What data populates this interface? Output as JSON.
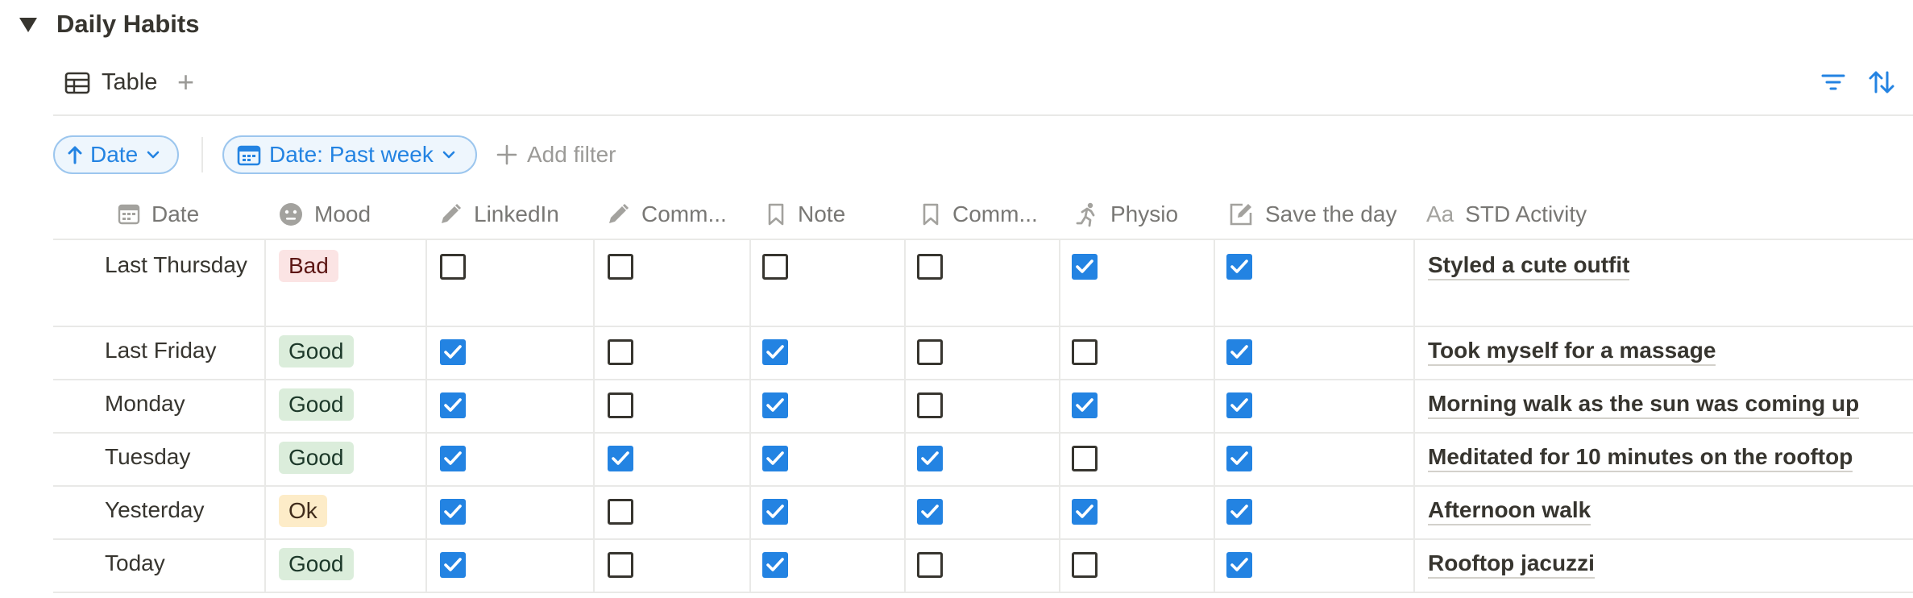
{
  "section": {
    "title": "Daily Habits"
  },
  "views": {
    "active_tab": "Table",
    "add_view_glyph": "+"
  },
  "toolbar": {
    "filter_icon": "filter-icon",
    "sort_icon": "sort-icon"
  },
  "filters": {
    "sort_pill": "Date",
    "date_filter_pill": "Date: Past week",
    "add_filter": "Add filter"
  },
  "columns": [
    {
      "label": "Date",
      "icon": "calendar-icon"
    },
    {
      "label": "Mood",
      "icon": "face-icon"
    },
    {
      "label": "LinkedIn",
      "icon": "pencil-icon"
    },
    {
      "label": "Comm...",
      "icon": "pencil-icon"
    },
    {
      "label": "Note",
      "icon": "bookmark-icon"
    },
    {
      "label": "Comm...",
      "icon": "bookmark-icon"
    },
    {
      "label": "Physio",
      "icon": "runner-icon"
    },
    {
      "label": "Save the day",
      "icon": "edit-square-icon"
    },
    {
      "label": "STD Activity",
      "icon": "text-aa-icon"
    }
  ],
  "mood_colors": {
    "Bad": {
      "bg": "#fbe4e4",
      "fg": "#5d1715"
    },
    "Good": {
      "bg": "#dbeddb",
      "fg": "#1c3829"
    },
    "Ok": {
      "bg": "#fdecc8",
      "fg": "#402c1b"
    }
  },
  "accent_color": "#2383e2",
  "rows": [
    {
      "date": "Last Thursday",
      "mood": "Bad",
      "checks": [
        false,
        false,
        false,
        false,
        true,
        true
      ],
      "activity": "Styled a cute outfit"
    },
    {
      "date": "Last Friday",
      "mood": "Good",
      "checks": [
        true,
        false,
        true,
        false,
        false,
        true
      ],
      "activity": "Took myself for a massage"
    },
    {
      "date": "Monday",
      "mood": "Good",
      "checks": [
        true,
        false,
        true,
        false,
        true,
        true
      ],
      "activity": "Morning walk as the sun was coming up"
    },
    {
      "date": "Tuesday",
      "mood": "Good",
      "checks": [
        true,
        true,
        true,
        true,
        false,
        true
      ],
      "activity": "Meditated for 10 minutes on the rooftop"
    },
    {
      "date": "Yesterday",
      "mood": "Ok",
      "checks": [
        true,
        false,
        true,
        true,
        true,
        true
      ],
      "activity": "Afternoon walk"
    },
    {
      "date": "Today",
      "mood": "Good",
      "checks": [
        true,
        false,
        true,
        false,
        false,
        true
      ],
      "activity": "Rooftop jacuzzi"
    }
  ]
}
